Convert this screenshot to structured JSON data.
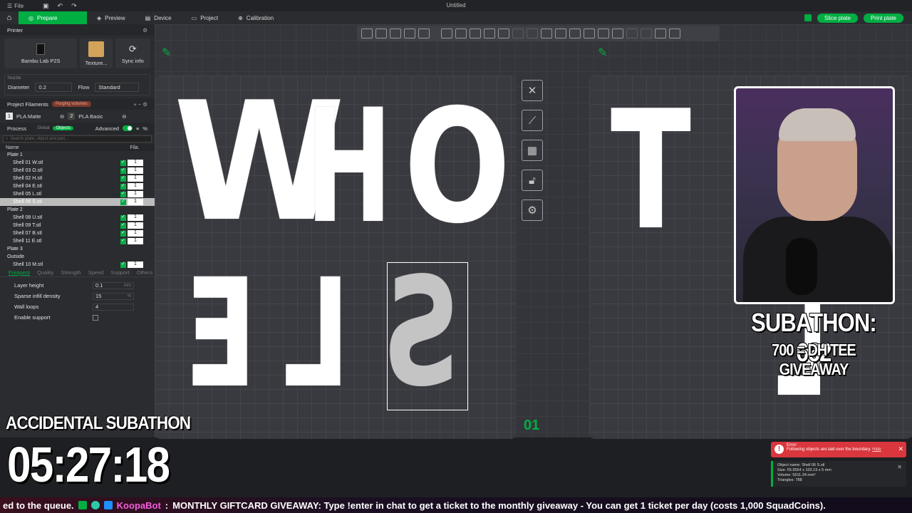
{
  "titlebar": {
    "file_menu": "File",
    "window_title": "Untitled"
  },
  "topbar": {
    "tabs": [
      "Prepare",
      "Preview",
      "Device",
      "Project",
      "Calibration"
    ],
    "slice_button": "Slice plate",
    "print_button": "Print plate"
  },
  "printer": {
    "section_title": "Printer",
    "printer_name": "Bambu Lab P2S",
    "plate_type": "Texture...",
    "sync_label": "Sync info",
    "nozzle_label": "Nozzle",
    "diameter_label": "Diameter",
    "diameter_value": "0.2",
    "flow_label": "Flow",
    "flow_value": "Standard"
  },
  "filaments": {
    "section_title": "Project Filaments",
    "badge": "Purging volumes",
    "items": [
      {
        "num": "1",
        "name": "PLA Matte"
      },
      {
        "num": "2",
        "name": "PLA Basic"
      }
    ]
  },
  "process": {
    "section_title": "Process",
    "global_label": "Global",
    "objects_label": "Objects",
    "advanced_label": "Advanced",
    "search_placeholder": "Search plate, object and part...",
    "col_name": "Name",
    "col_fila": "Fila.",
    "rows": [
      {
        "type": "group",
        "name": "Plate 1"
      },
      {
        "type": "item",
        "name": "Shell 01 W.stl",
        "fila": "1"
      },
      {
        "type": "item",
        "name": "Shell 03 O.stl",
        "fila": "1"
      },
      {
        "type": "item",
        "name": "Shell 02 H.stl",
        "fila": "1"
      },
      {
        "type": "item",
        "name": "Shell 04 E.stl",
        "fila": "1"
      },
      {
        "type": "item",
        "name": "Shell 05 L.stl",
        "fila": "1"
      },
      {
        "type": "item",
        "name": "Shell 06 S.stl",
        "fila": "1",
        "selected": true
      },
      {
        "type": "group",
        "name": "Plate 2"
      },
      {
        "type": "item",
        "name": "Shell 08 U.stl",
        "fila": "1"
      },
      {
        "type": "item",
        "name": "Shell 09 T.stl",
        "fila": "1"
      },
      {
        "type": "item",
        "name": "Shell 07 B.stl",
        "fila": "1"
      },
      {
        "type": "item",
        "name": "Shell  11 E.stl",
        "fila": "1"
      },
      {
        "type": "group",
        "name": "Plate 3"
      },
      {
        "type": "group",
        "name": "Outside"
      },
      {
        "type": "item",
        "name": "Shell 10 M.stl",
        "fila": "1"
      }
    ],
    "quality_tabs": [
      "Frequent",
      "Quality",
      "Strength",
      "Speed",
      "Support",
      "Others"
    ],
    "params": [
      {
        "label": "Layer height",
        "value": "0.1",
        "unit": "mm"
      },
      {
        "label": "Sparse infill density",
        "value": "15",
        "unit": "%"
      },
      {
        "label": "Wall loops",
        "value": "4",
        "unit": ""
      },
      {
        "label": "Enable support",
        "value": "",
        "unit": ""
      }
    ]
  },
  "viewport": {
    "plate_number": "01",
    "letters_top": [
      "W",
      "H",
      "O"
    ],
    "letters_bottom": [
      "Ǝ",
      "⅃",
      "S"
    ],
    "plate2_letter": "T",
    "plate2_bottom": "⅃"
  },
  "overlay": {
    "subathon_count": "SUBATHON: 662",
    "giveaway": "700 = DH TEE GIVEAWAY",
    "title": "ACCIDENTAL SUBATHON",
    "timer": "05:27:18"
  },
  "error": {
    "title": "Error:",
    "message": "Following objects are laid over the boundary.",
    "link": "Hide"
  },
  "info": {
    "object_name": "Object name: Shell 06 S.stl",
    "size": "Size: 55.9554 x 103.19 x 5 mm",
    "volume": "Volume: 5511.34 mm³",
    "triangles": "Triangles: 788"
  },
  "ticker": {
    "prefix": "ed to the queue.",
    "bot_name": "KoopaBot",
    "message": "MONTHLY GIFTCARD GIVEAWAY: Type !enter in chat to get a ticket to the monthly giveaway - You can get 1 ticket per day (costs 1,000 SquadCoins)."
  }
}
